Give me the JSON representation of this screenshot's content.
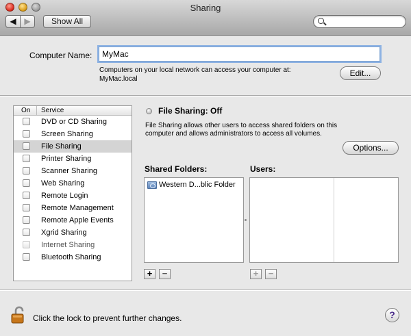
{
  "window": {
    "title": "Sharing"
  },
  "toolbar": {
    "back_symbol": "◀",
    "forward_symbol": "▶",
    "show_all_label": "Show All",
    "search_value": "",
    "search_placeholder": ""
  },
  "computer_name": {
    "label": "Computer Name:",
    "value": "MyMac",
    "address_line1": "Computers on your local network can access your computer at:",
    "address_line2": "MyMac.local",
    "edit_label": "Edit..."
  },
  "services": {
    "header_on": "On",
    "header_service": "Service",
    "items": [
      {
        "label": "DVD or CD Sharing",
        "checked": false,
        "selected": false,
        "enabled": true
      },
      {
        "label": "Screen Sharing",
        "checked": false,
        "selected": false,
        "enabled": true
      },
      {
        "label": "File Sharing",
        "checked": false,
        "selected": true,
        "enabled": true
      },
      {
        "label": "Printer Sharing",
        "checked": false,
        "selected": false,
        "enabled": true
      },
      {
        "label": "Scanner Sharing",
        "checked": false,
        "selected": false,
        "enabled": true
      },
      {
        "label": "Web Sharing",
        "checked": false,
        "selected": false,
        "enabled": true
      },
      {
        "label": "Remote Login",
        "checked": false,
        "selected": false,
        "enabled": true
      },
      {
        "label": "Remote Management",
        "checked": false,
        "selected": false,
        "enabled": true
      },
      {
        "label": "Remote Apple Events",
        "checked": false,
        "selected": false,
        "enabled": true
      },
      {
        "label": "Xgrid Sharing",
        "checked": false,
        "selected": false,
        "enabled": true
      },
      {
        "label": "Internet Sharing",
        "checked": false,
        "selected": false,
        "enabled": false
      },
      {
        "label": "Bluetooth Sharing",
        "checked": false,
        "selected": false,
        "enabled": true
      }
    ]
  },
  "detail": {
    "status_label": "File Sharing: Off",
    "description": "File Sharing allows other users to access shared folders on this computer and allows administrators to access all volumes.",
    "options_label": "Options...",
    "shared_folders_label": "Shared Folders:",
    "users_label": "Users:",
    "shared_folders": [
      "Western D...blic Folder"
    ],
    "add_symbol": "+",
    "remove_symbol": "−"
  },
  "footer": {
    "lock_text": "Click the lock to prevent further changes.",
    "help_symbol": "?"
  },
  "colors": {
    "focus_ring": "#8db2e3",
    "selected_row": "#d4d4d4",
    "lock_body": "#c7761a"
  }
}
